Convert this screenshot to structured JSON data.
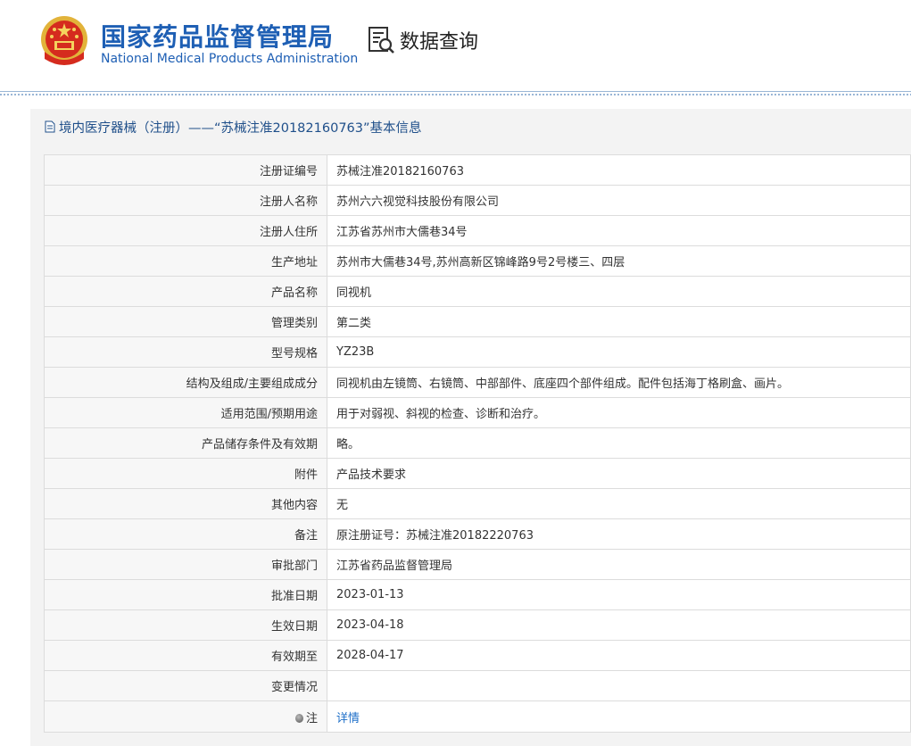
{
  "header": {
    "org_name_cn": "国家药品监督管理局",
    "org_name_en": "National Medical Products Administration",
    "data_query_label": "数据查询",
    "emblem_icon": "national-emblem-icon",
    "query_icon": "document-search-icon"
  },
  "panel": {
    "title": "境内医疗器械（注册）——“苏械注准20182160763”基本信息",
    "title_icon": "document-icon"
  },
  "rows": [
    {
      "label": "注册证编号",
      "value": "苏械注准20182160763"
    },
    {
      "label": "注册人名称",
      "value": "苏州六六视觉科技股份有限公司"
    },
    {
      "label": "注册人住所",
      "value": "江苏省苏州市大儒巷34号"
    },
    {
      "label": "生产地址",
      "value": "苏州市大儒巷34号,苏州高新区锦峰路9号2号楼三、四层"
    },
    {
      "label": "产品名称",
      "value": "同视机"
    },
    {
      "label": "管理类别",
      "value": "第二类"
    },
    {
      "label": "型号规格",
      "value": "YZ23B"
    },
    {
      "label": "结构及组成/主要组成成分",
      "value": "同视机由左镜筒、右镜筒、中部部件、底座四个部件组成。配件包括海丁格刷盒、画片。"
    },
    {
      "label": "适用范围/预期用途",
      "value": "用于对弱视、斜视的检查、诊断和治疗。"
    },
    {
      "label": "产品储存条件及有效期",
      "value": "略。"
    },
    {
      "label": "附件",
      "value": "产品技术要求"
    },
    {
      "label": "其他内容",
      "value": "无"
    },
    {
      "label": "备注",
      "value": "原注册证号：苏械注准20182220763"
    },
    {
      "label": "审批部门",
      "value": "江苏省药品监督管理局"
    },
    {
      "label": "批准日期",
      "value": "2023-01-13"
    },
    {
      "label": "生效日期",
      "value": "2023-04-18"
    },
    {
      "label": "有效期至",
      "value": "2028-04-17"
    },
    {
      "label": "变更情况",
      "value": ""
    }
  ],
  "note_row": {
    "label": "注",
    "link_text": "详情",
    "icon": "bullet-note-icon"
  },
  "colors": {
    "brand_blue": "#1e5fb4",
    "title_blue": "#1f4f8a",
    "link_blue": "#1e6fc8"
  }
}
